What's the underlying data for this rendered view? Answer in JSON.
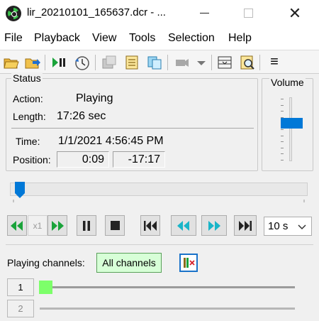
{
  "window": {
    "title": "lir_20210101_165637.dcr - ...",
    "minimize_glyph": "",
    "close_glyph": "✕"
  },
  "menu": {
    "items": [
      "File",
      "Playback",
      "View",
      "Tools",
      "Selection",
      "Help"
    ]
  },
  "toolbar": {
    "icons": [
      "open-folder-icon",
      "export-icon",
      "play-pause-icon",
      "time-sync-icon",
      "properties-icon",
      "notes-icon",
      "copy-icon",
      "camera-icon",
      "camera-dropdown-icon",
      "layout-icon",
      "preview-icon",
      "menu-icon"
    ],
    "menu_glyph": "≡"
  },
  "status": {
    "title": "Status",
    "action_label": "Action:",
    "action_value": "Playing",
    "length_label": "Length:",
    "length_value": "17:26 sec",
    "time_label": "Time:",
    "time_value": "1/1/2021 4:56:45 PM",
    "position_label": "Position:",
    "position_value": "0:09",
    "remaining_value": "-17:17"
  },
  "volume": {
    "title": "Volume",
    "level_fraction": 0.62
  },
  "playback_position": {
    "fraction": 0.01
  },
  "transport": {
    "speed_label": "x1",
    "step_select_value": "10 s"
  },
  "channels": {
    "label": "Playing channels:",
    "all_button_label": "All channels",
    "rows": [
      {
        "number": "1",
        "active": true
      },
      {
        "number": "2",
        "active": false
      }
    ]
  },
  "colors": {
    "accent": "#0078d7",
    "play_green": "#1aa33a",
    "skip_teal": "#19b5c8",
    "channel_green": "#7dff6a",
    "all_channels_bg": "#d7ffd7"
  }
}
